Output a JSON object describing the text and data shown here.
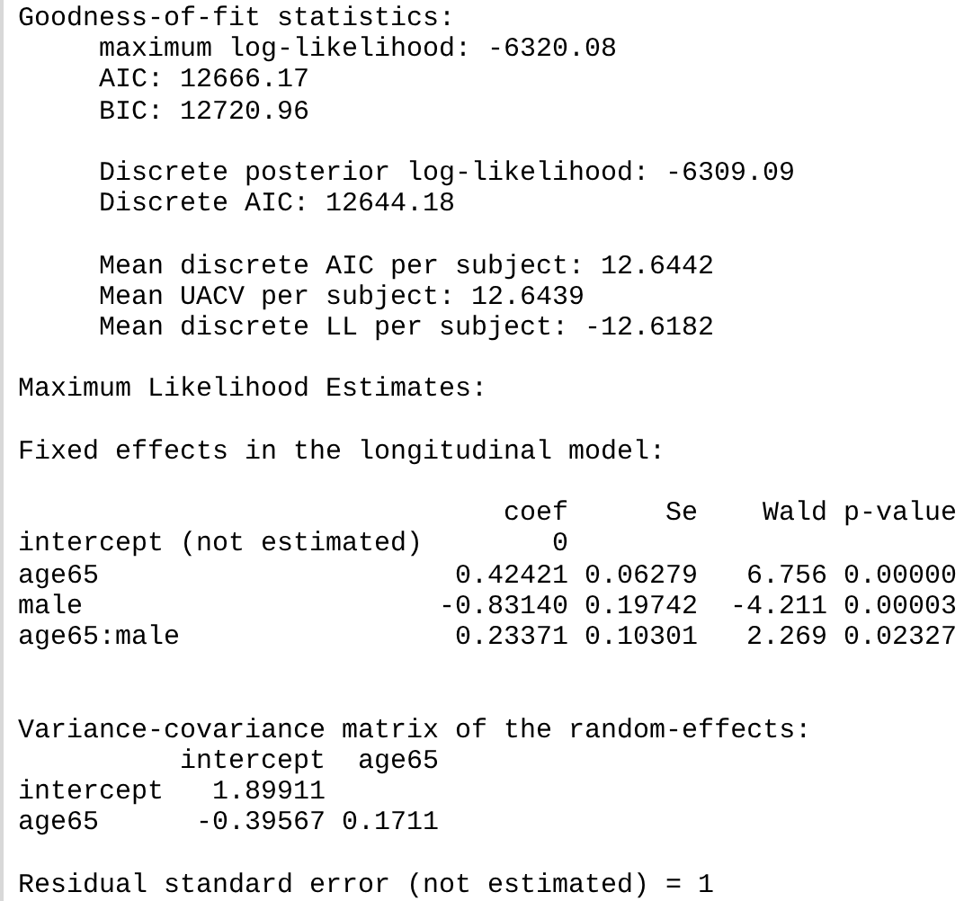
{
  "goodness_of_fit": {
    "title": "Goodness-of-fit statistics:",
    "groups": [
      [
        "maximum log-likelihood: -6320.08",
        "AIC: 12666.17",
        "BIC: 12720.96"
      ],
      [
        "Discrete posterior log-likelihood: -6309.09",
        "Discrete AIC: 12644.18"
      ],
      [
        "Mean discrete AIC per subject: 12.6442",
        "Mean UACV per subject: 12.6439",
        "Mean discrete LL per subject: -12.6182"
      ]
    ]
  },
  "estimates_title": "Maximum Likelihood Estimates:",
  "fixed_effects": {
    "title": "Fixed effects in the longitudinal model:",
    "columns": [
      "coef",
      "Se",
      "Wald",
      "p-value"
    ],
    "rows": [
      {
        "term": "intercept (not estimated)",
        "values": [
          "0"
        ]
      },
      {
        "term": "age65",
        "values": [
          "0.42421",
          "0.06279",
          "6.756",
          "0.00000"
        ]
      },
      {
        "term": "male",
        "values": [
          "-0.83140",
          "0.19742",
          "-4.211",
          "0.00003"
        ]
      },
      {
        "term": "age65:male",
        "values": [
          "0.23371",
          "0.10301",
          "2.269",
          "0.02327"
        ]
      }
    ]
  },
  "random_effects": {
    "title": "Variance-covariance matrix of the random-effects:",
    "columns": [
      "intercept",
      "age65"
    ],
    "rows": [
      {
        "term": "intercept",
        "values": [
          "1.89911"
        ]
      },
      {
        "term": "age65",
        "values": [
          "-0.39567",
          "0.1711"
        ]
      }
    ]
  },
  "residual": "Residual standard error (not estimated) = 1"
}
